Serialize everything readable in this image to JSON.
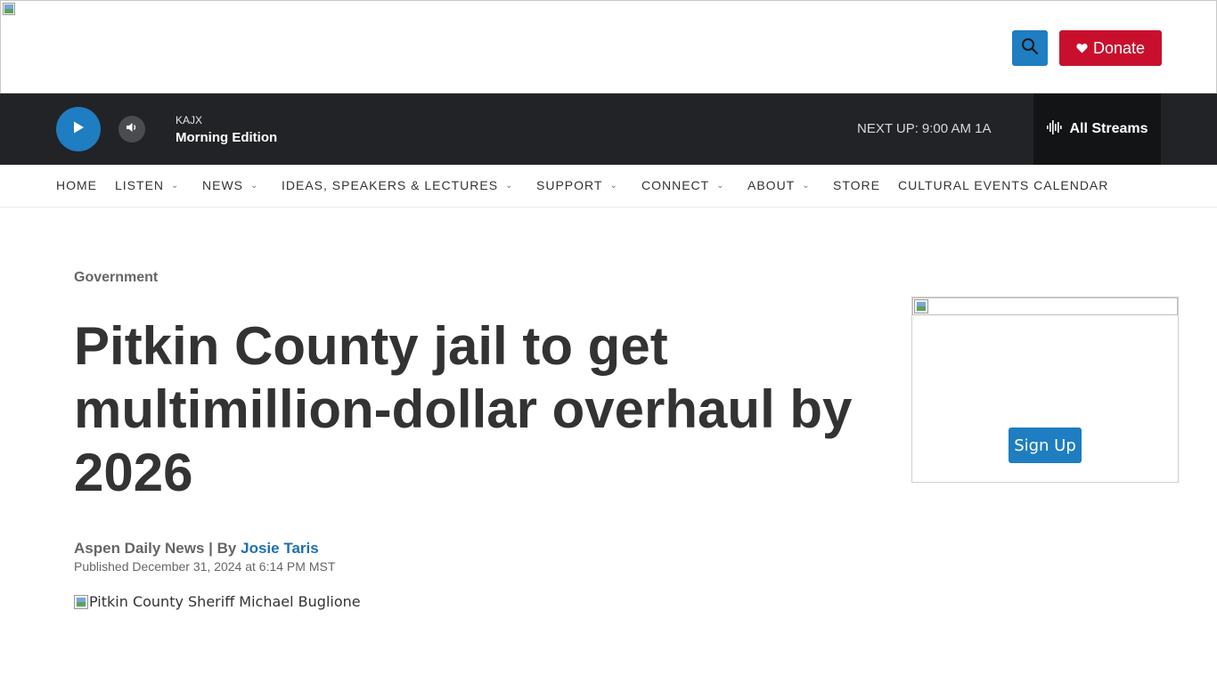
{
  "header": {
    "donate_label": "Donate"
  },
  "player": {
    "station": "KAJX",
    "program": "Morning Edition",
    "next_up_label": "NEXT UP:",
    "next_up_time": "9:00 AM 1A",
    "all_streams_label": "All Streams"
  },
  "nav": {
    "items": [
      {
        "label": "HOME"
      },
      {
        "label": "LISTEN"
      },
      {
        "label": "NEWS"
      },
      {
        "label": "IDEAS, SPEAKERS & LECTURES"
      },
      {
        "label": "SUPPORT"
      },
      {
        "label": "CONNECT"
      },
      {
        "label": "ABOUT"
      },
      {
        "label": "STORE"
      },
      {
        "label": "CULTURAL EVENTS CALENDAR"
      }
    ]
  },
  "article": {
    "category": "Government",
    "headline": "Pitkin County jail to get multimillion-dollar overhaul by 2026",
    "source": "Aspen Daily News",
    "by_separator": " | By ",
    "author": "Josie Taris",
    "published": "Published December 31, 2024 at 6:14 PM MST",
    "hero_image_alt": "Pitkin County Sheriff Michael Buglione"
  },
  "sidebar": {
    "signup_label": "Sign Up"
  },
  "colors": {
    "accent_blue": "#1f7dc1",
    "donate_red": "#c8102e",
    "player_bg": "#222326",
    "author_link": "#1f6fae"
  }
}
